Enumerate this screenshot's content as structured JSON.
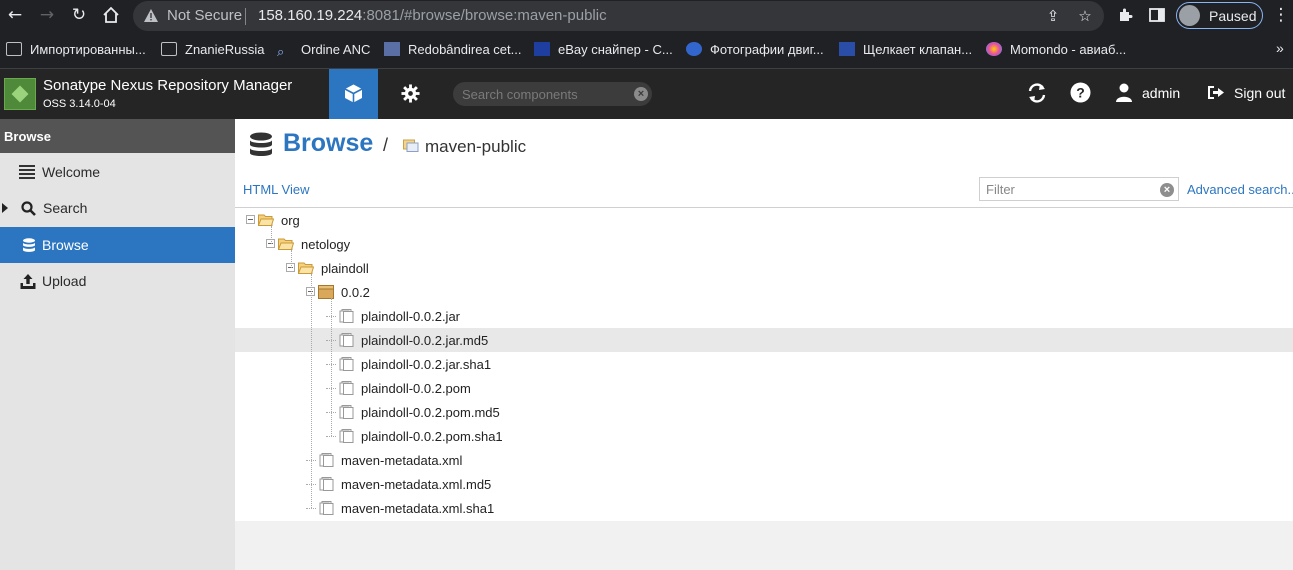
{
  "browser": {
    "security_label": "Not Secure",
    "url_host": "158.160.19.224",
    "url_rest": ":8081/#browse/browse:maven-public",
    "profile_status": "Paused",
    "bookmarks": [
      "Импортированны...",
      "ZnanieRussia",
      "Ordine ANC",
      "Redobândirea cet...",
      "eBay снайпер - С...",
      "Фотографии двиг...",
      "Щелкает клапан...",
      "Momondo - авиаб..."
    ],
    "bookmarks_more": "»"
  },
  "app": {
    "title": "Sonatype Nexus Repository Manager",
    "version": "OSS 3.14.0-04",
    "search_placeholder": "Search components",
    "user": "admin",
    "sign_out": "Sign out"
  },
  "sidebar": {
    "header": "Browse",
    "items": [
      {
        "label": "Welcome",
        "icon": "list-icon"
      },
      {
        "label": "Search",
        "icon": "search-icon"
      },
      {
        "label": "Browse",
        "icon": "database-icon",
        "active": true
      },
      {
        "label": "Upload",
        "icon": "upload-icon"
      }
    ]
  },
  "main": {
    "title": "Browse",
    "separator": "/",
    "repository": "maven-public",
    "html_view": "HTML View",
    "filter_placeholder": "Filter",
    "advanced_search": "Advanced search..."
  },
  "tree": [
    {
      "label": "org",
      "type": "folder",
      "depth": 0,
      "expanded": true
    },
    {
      "label": "netology",
      "type": "folder",
      "depth": 1,
      "expanded": true
    },
    {
      "label": "plaindoll",
      "type": "folder",
      "depth": 2,
      "expanded": true
    },
    {
      "label": "0.0.2",
      "type": "component",
      "depth": 3,
      "expanded": true
    },
    {
      "label": "plaindoll-0.0.2.jar",
      "type": "asset",
      "depth": 4
    },
    {
      "label": "plaindoll-0.0.2.jar.md5",
      "type": "asset",
      "depth": 4,
      "selected": true
    },
    {
      "label": "plaindoll-0.0.2.jar.sha1",
      "type": "asset",
      "depth": 4
    },
    {
      "label": "plaindoll-0.0.2.pom",
      "type": "asset",
      "depth": 4
    },
    {
      "label": "plaindoll-0.0.2.pom.md5",
      "type": "asset",
      "depth": 4
    },
    {
      "label": "plaindoll-0.0.2.pom.sha1",
      "type": "asset",
      "depth": 4
    },
    {
      "label": "maven-metadata.xml",
      "type": "asset",
      "depth": 3
    },
    {
      "label": "maven-metadata.xml.md5",
      "type": "asset",
      "depth": 3
    },
    {
      "label": "maven-metadata.xml.sha1",
      "type": "asset",
      "depth": 3
    }
  ]
}
